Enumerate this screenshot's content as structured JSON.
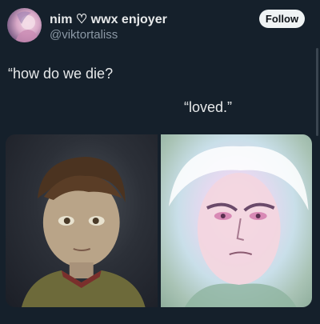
{
  "author": {
    "display_name": "nim ♡ wwx enjoyer",
    "handle": "@viktortaliss"
  },
  "follow_label": "Follow",
  "post_text": {
    "line_1": "“how do we die?",
    "line_2": "“loved.”"
  },
  "media": [
    {
      "icon": "child-character-portrait"
    },
    {
      "icon": "glowing-adult-character-portrait"
    }
  ],
  "colors": {
    "background": "#15202b",
    "text_primary": "#e7e9ea",
    "text_secondary": "#8b98a5",
    "follow_button_bg": "#eff3f4"
  }
}
